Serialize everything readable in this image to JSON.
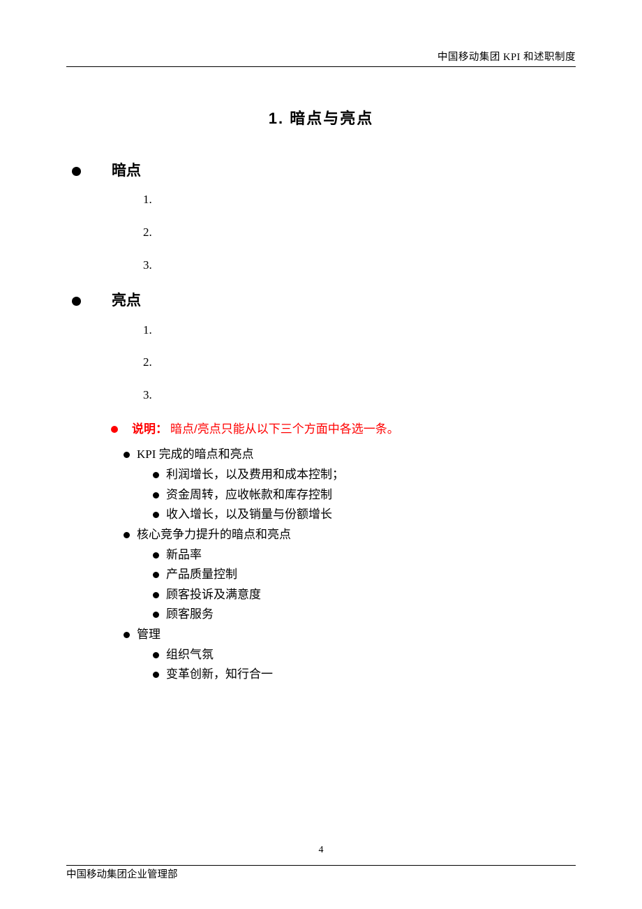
{
  "header": "中国移动集团 KPI 和述职制度",
  "title": "1.  暗点与亮点",
  "sections": [
    {
      "label": "暗点",
      "items": [
        "1.",
        "2.",
        "3."
      ]
    },
    {
      "label": "亮点",
      "items": [
        "1.",
        "2.",
        "3."
      ]
    }
  ],
  "note": {
    "label": "说明：",
    "text": "暗点/亮点只能从以下三个方面中各选一条。"
  },
  "tree": [
    {
      "level": 1,
      "text": "KPI 完成的暗点和亮点"
    },
    {
      "level": 2,
      "text": "利润增长，以及费用和成本控制；"
    },
    {
      "level": 2,
      "text": "资金周转，应收帐款和库存控制"
    },
    {
      "level": 2,
      "text": "收入增长，以及销量与份额增长"
    },
    {
      "level": 1,
      "text": "核心竞争力提升的暗点和亮点"
    },
    {
      "level": 2,
      "text": "新品率"
    },
    {
      "level": 2,
      "text": "产品质量控制"
    },
    {
      "level": 2,
      "text": "顾客投诉及满意度"
    },
    {
      "level": 2,
      "text": "顾客服务"
    },
    {
      "level": 1,
      "text": "管理"
    },
    {
      "level": 2,
      "text": "组织气氛"
    },
    {
      "level": 2,
      "text": "变革创新，知行合一"
    }
  ],
  "footer": {
    "page": "4",
    "org": "中国移动集团企业管理部"
  }
}
